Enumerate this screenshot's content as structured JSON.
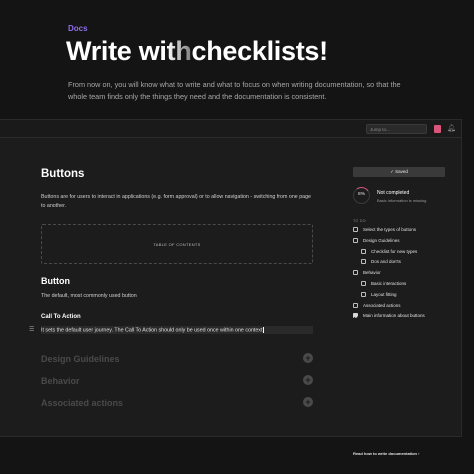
{
  "hero": {
    "tag": "Docs",
    "title_bright": "Write wi",
    "title_faded": "th",
    "title_rest": "checklists!",
    "description": "From now on, you will know what to write and what to focus on when writing documentation, so that the whole team finds only the things they need and the documentation is consistent."
  },
  "topbar": {
    "search_placeholder": "Jump to...",
    "bell_icon": "bell-icon",
    "colors": {
      "avatar": "#d9557a"
    }
  },
  "main": {
    "title": "Buttons",
    "description": "Buttons are for users to interact in applications (e.g. form approval) or to allow navigation - switching from one page to another.",
    "toc_label": "TABLE OF CONTENTS",
    "section_title": "Button",
    "section_desc": "The default, most commonly used button",
    "cta_title": "Call To Action",
    "cta_text": "It sets the default user journey. The Call To Action should only be used once within one context",
    "collapsed": [
      {
        "label": "Design Guidelines"
      },
      {
        "label": "Behavior"
      },
      {
        "label": "Associated actions"
      }
    ]
  },
  "sidebar": {
    "saved_label": "✓ Saved",
    "progress_label": "8%",
    "progress_value": 0.08,
    "status_title": "Not completed",
    "status_sub": "Basic information is missing",
    "todo_label": "TO DO",
    "items": [
      {
        "label": "Select the types of buttons",
        "level": 0,
        "checked": false
      },
      {
        "label": "Design Guidelines",
        "level": 0,
        "checked": false
      },
      {
        "label": "Checklist for new types",
        "level": 1,
        "checked": false
      },
      {
        "label": "Dos and don'ts",
        "level": 1,
        "checked": false
      },
      {
        "label": "Behavior",
        "level": 0,
        "checked": false
      },
      {
        "label": "Basic interactions",
        "level": 1,
        "checked": false
      },
      {
        "label": "Layout fitting",
        "level": 1,
        "checked": false
      },
      {
        "label": "Associated actions",
        "level": 0,
        "checked": false
      },
      {
        "label": "Main information about buttons",
        "level": 0,
        "checked": true
      }
    ],
    "read_how": "Read how to write documentation  ›"
  }
}
